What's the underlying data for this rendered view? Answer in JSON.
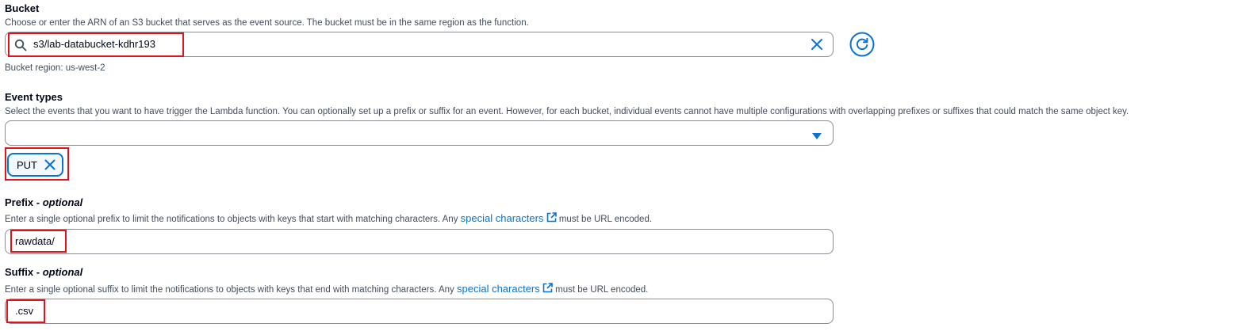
{
  "bucket": {
    "label": "Bucket",
    "description": "Choose or enter the ARN of an S3 bucket that serves as the event source. The bucket must be in the same region as the function.",
    "value": "s3/lab-databucket-kdhr193",
    "region_text": "Bucket region: us-west-2",
    "icons": [
      "search-icon",
      "clear-icon",
      "refresh-icon"
    ]
  },
  "event_types": {
    "label": "Event types",
    "description": "Select the events that you want to have trigger the Lambda function. You can optionally set up a prefix or suffix for an event. However, for each bucket, individual events cannot have multiple configurations with overlapping prefixes or suffixes that could match the same object key.",
    "selected_tokens": [
      {
        "label": "PUT"
      }
    ],
    "icons": [
      "caret-down-icon",
      "remove-token-icon"
    ]
  },
  "prefix": {
    "label": "Prefix",
    "label_suffix": "optional",
    "description_before": "Enter a single optional prefix to limit the notifications to objects with keys that start with matching characters. Any",
    "link_text": "special characters",
    "description_after": "must be URL encoded.",
    "value": "rawdata/",
    "icons": [
      "external-link-icon"
    ]
  },
  "suffix": {
    "label": "Suffix",
    "label_suffix": "optional",
    "description_before": "Enter a single optional suffix to limit the notifications to objects with keys that end with matching characters. Any",
    "link_text": "special characters",
    "description_after": "must be URL encoded.",
    "value": ".csv",
    "icons": [
      "external-link-icon"
    ]
  },
  "colors": {
    "accent": "#0972d3",
    "highlight": "#e0141e",
    "label_text": "#000716",
    "description_text": "#414d5c",
    "input_border": "#8c8c94"
  }
}
